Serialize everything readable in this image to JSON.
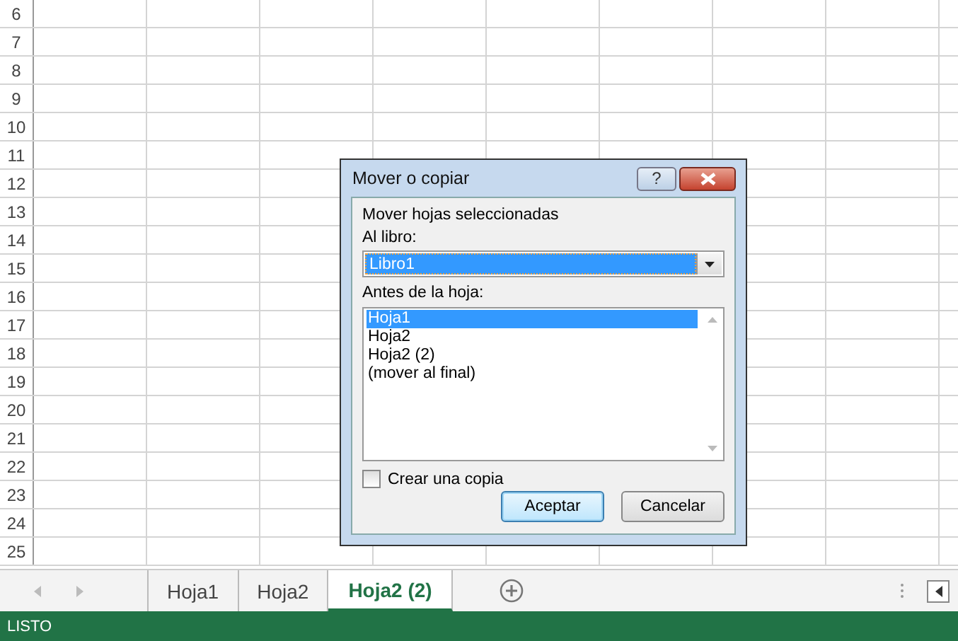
{
  "sheet": {
    "row_numbers": [
      "6",
      "7",
      "8",
      "9",
      "10",
      "11",
      "12",
      "13",
      "14",
      "15",
      "16",
      "17",
      "18",
      "19",
      "20",
      "21",
      "22",
      "23",
      "24",
      "25"
    ]
  },
  "dialog": {
    "title": "Mover o copiar",
    "help_button": "?",
    "heading": "Mover hojas seleccionadas",
    "book_label": "Al libro:",
    "book_value": "Libro1",
    "before_label": "Antes de la hoja:",
    "sheets": [
      {
        "label": "Hoja1",
        "selected": true
      },
      {
        "label": "Hoja2",
        "selected": false
      },
      {
        "label": "Hoja2 (2)",
        "selected": false
      },
      {
        "label": "(mover al final)",
        "selected": false
      }
    ],
    "copy_checkbox": {
      "label": "Crear una copia",
      "checked": false
    },
    "buttons": [
      {
        "label": "Aceptar",
        "default": true
      },
      {
        "label": "Cancelar",
        "default": false
      }
    ]
  },
  "tabs": [
    {
      "label": "Hoja1",
      "selected": false
    },
    {
      "label": "Hoja2",
      "selected": false
    },
    {
      "label": "Hoja2 (2)",
      "selected": true
    }
  ],
  "status_bar": {
    "text": "LISTO"
  }
}
